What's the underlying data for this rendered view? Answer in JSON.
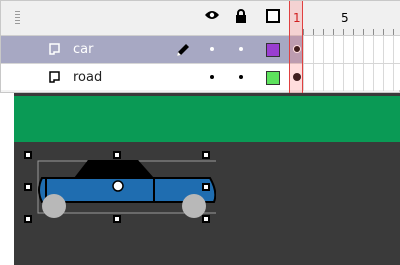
{
  "timeline": {
    "frame_labels": [
      "1",
      "5"
    ],
    "current_frame": "1",
    "layers": [
      {
        "name": "car",
        "selected": true,
        "editing": true,
        "outline_color": "#9a3fd1"
      },
      {
        "name": "road",
        "selected": false,
        "editing": false,
        "outline_color": "#5de25d"
      }
    ],
    "column_icons": [
      "eye-icon",
      "lock-icon",
      "outline-square-icon"
    ]
  },
  "stage": {
    "background_color": "#3a3a3a",
    "road_color": "#0a9a55",
    "car_body_color": "#1f6db0",
    "car_roof_color": "#000000",
    "wheel_color": "#b8b8b8"
  }
}
